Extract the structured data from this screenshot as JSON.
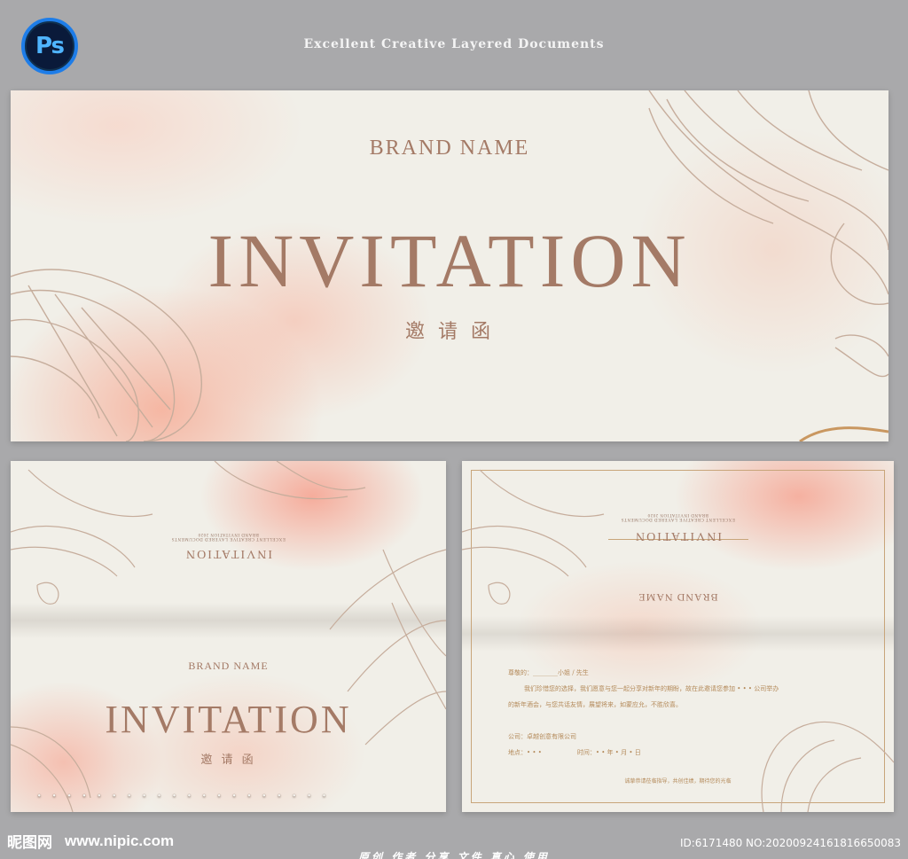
{
  "header": {
    "ps_label": "Ps",
    "tagline": "Excellent Creative Layered Documents"
  },
  "main_card": {
    "brand": "BRAND NAME",
    "title": "INVITATION",
    "subtitle": "邀 请 函",
    "dotted_line": "• • • • • • • •   • • • •   • •   • • • • • •"
  },
  "inner_card": {
    "top_small_1": "BRAND INVITATION 2020",
    "top_small_2": "EXCELLENT CREATIVE LAYERED DOCUMENTS",
    "title_flipped": "INVITATION",
    "brand": "BRAND NAME",
    "title": "INVITATION",
    "subtitle": "邀 请 函",
    "dotted_line": "• • • • • • • •   • • • •   • •   • • • • • •"
  },
  "letter_card": {
    "top_small_1": "BRAND INVITATION 2020",
    "top_small_2": "EXCELLENT CREATIVE LAYERED DOCUMENTS",
    "title_flipped": "INVITATION",
    "brand_flipped": "BRAND NAME",
    "salutation": "尊敬的：________小姐 / 先生",
    "body_1": "我们珍惜您的选择，我们愿意与您一起分享对新年的期盼，故在此邀请您参加 • • • 公司举办",
    "body_2": "的新年酒会，与您共话友情，展望将来，如蒙应允，不胜欣喜。",
    "company": "公司：卓越创意有限公司",
    "place": "地点：• • •",
    "time": "时间：• • 年 • 月 • 日",
    "footnote": "诚挚恭请莅临指导，共创佳绩，期待您的光临"
  },
  "footer": {
    "site_logo": "昵图网",
    "site_url": "www.nipic.com",
    "id_text": "ID:6171480 NO:20200924161816650083",
    "slogan": "原创 作者 分享 文件 真心 使用"
  },
  "colors": {
    "background": "#a9a9ab",
    "paper": "#f1efe8",
    "accent": "#a47a66",
    "wash": "#f5b5a3"
  }
}
